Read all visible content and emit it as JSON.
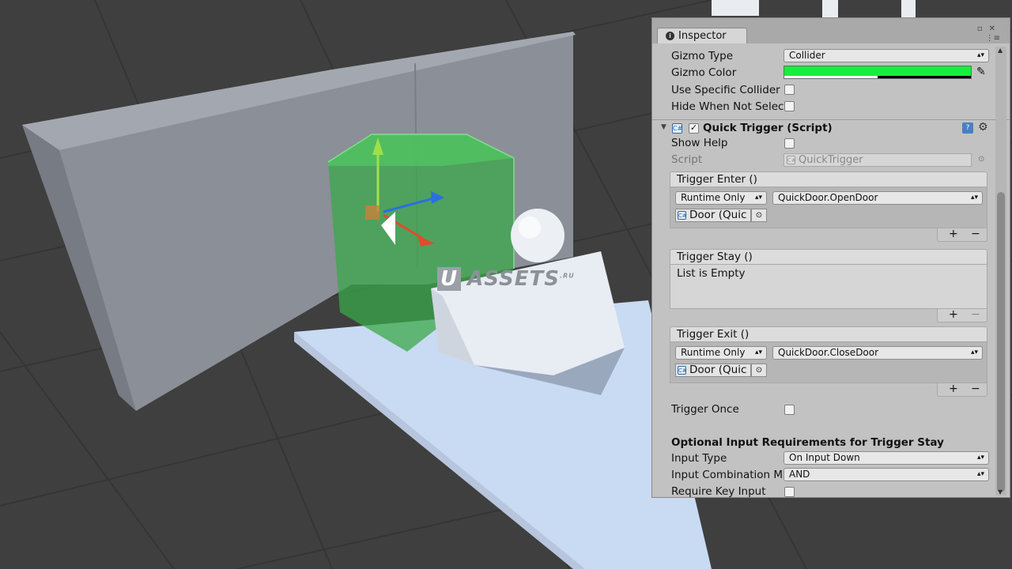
{
  "watermark": {
    "letter": "U",
    "text": "ASSETS",
    "suffix": ".RU"
  },
  "inspector": {
    "tab_label": "Inspector",
    "gizmo_type": {
      "label": "Gizmo Type",
      "value": "Collider"
    },
    "gizmo_color": {
      "label": "Gizmo Color",
      "value": "#14f03a"
    },
    "use_specific_collider": {
      "label": "Use Specific Collider",
      "checked": false
    },
    "hide_when_not_selected": {
      "label": "Hide When Not Selec",
      "checked": false
    },
    "component": {
      "title": "Quick Trigger (Script)",
      "enabled": true,
      "show_help": {
        "label": "Show Help",
        "checked": false
      },
      "script": {
        "label": "Script",
        "value": "QuickTrigger"
      }
    },
    "events": [
      {
        "title": "Trigger Enter ()",
        "runtime": "Runtime Only",
        "method": "QuickDoor.OpenDoor",
        "object": "Door (Quic"
      },
      {
        "title": "Trigger Stay ()",
        "empty_text": "List is Empty"
      },
      {
        "title": "Trigger Exit ()",
        "runtime": "Runtime Only",
        "method": "QuickDoor.CloseDoor",
        "object": "Door (Quic"
      }
    ],
    "list_add": "+",
    "list_remove": "−",
    "trigger_once": {
      "label": "Trigger Once",
      "checked": false
    },
    "optional_section": "Optional Input Requirements for Trigger Stay",
    "input_type": {
      "label": "Input Type",
      "value": "On Input Down"
    },
    "input_combination": {
      "label": "Input Combination M",
      "value": "AND"
    },
    "require_key_input": {
      "label": "Require Key Input",
      "checked": false
    }
  }
}
